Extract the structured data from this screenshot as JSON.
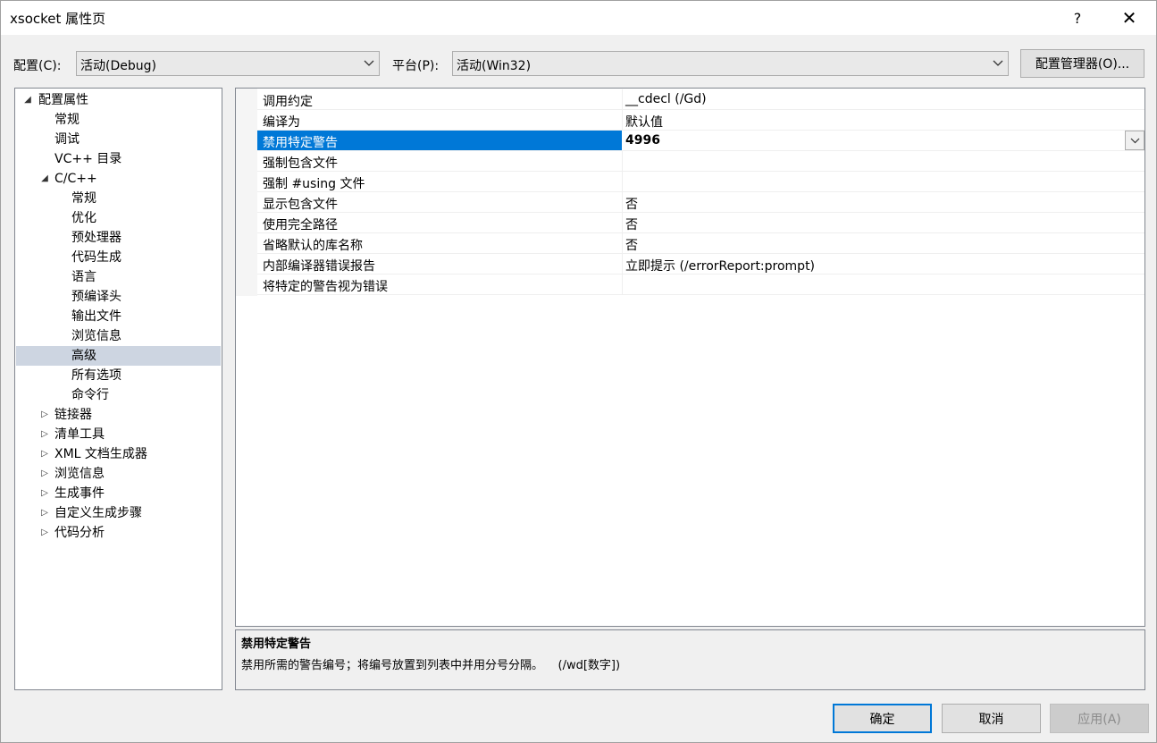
{
  "window": {
    "title": "xsocket 属性页",
    "help": "?",
    "close": "✕"
  },
  "toolbar": {
    "config_label": "配置(C):",
    "config_value": "活动(Debug)",
    "platform_label": "平台(P):",
    "platform_value": "活动(Win32)",
    "config_manager": "配置管理器(O)..."
  },
  "tree": {
    "root": "配置属性",
    "general": "常规",
    "debugging": "调试",
    "vcdirs": "VC++ 目录",
    "cpp": "C/C++",
    "cpp_items": [
      "常规",
      "优化",
      "预处理器",
      "代码生成",
      "语言",
      "预编译头",
      "输出文件",
      "浏览信息",
      "高级",
      "所有选项",
      "命令行"
    ],
    "collapsed": [
      "链接器",
      "清单工具",
      "XML 文档生成器",
      "浏览信息",
      "生成事件",
      "自定义生成步骤",
      "代码分析"
    ]
  },
  "grid": {
    "rows": [
      {
        "name": "调用约定",
        "value": "__cdecl (/Gd)"
      },
      {
        "name": "编译为",
        "value": "默认值"
      },
      {
        "name": "禁用特定警告",
        "value": "4996"
      },
      {
        "name": "强制包含文件",
        "value": ""
      },
      {
        "name": "强制 #using 文件",
        "value": ""
      },
      {
        "name": "显示包含文件",
        "value": "否"
      },
      {
        "name": "使用完全路径",
        "value": "否"
      },
      {
        "name": "省略默认的库名称",
        "value": "否"
      },
      {
        "name": "内部编译器错误报告",
        "value": "立即提示 (/errorReport:prompt)"
      },
      {
        "name": "将特定的警告视为错误",
        "value": ""
      }
    ]
  },
  "description": {
    "title": "禁用特定警告",
    "text": "禁用所需的警告编号；将编号放置到列表中并用分号分隔。    (/wd[数字])"
  },
  "buttons": {
    "ok": "确定",
    "cancel": "取消",
    "apply": "应用(A)"
  }
}
